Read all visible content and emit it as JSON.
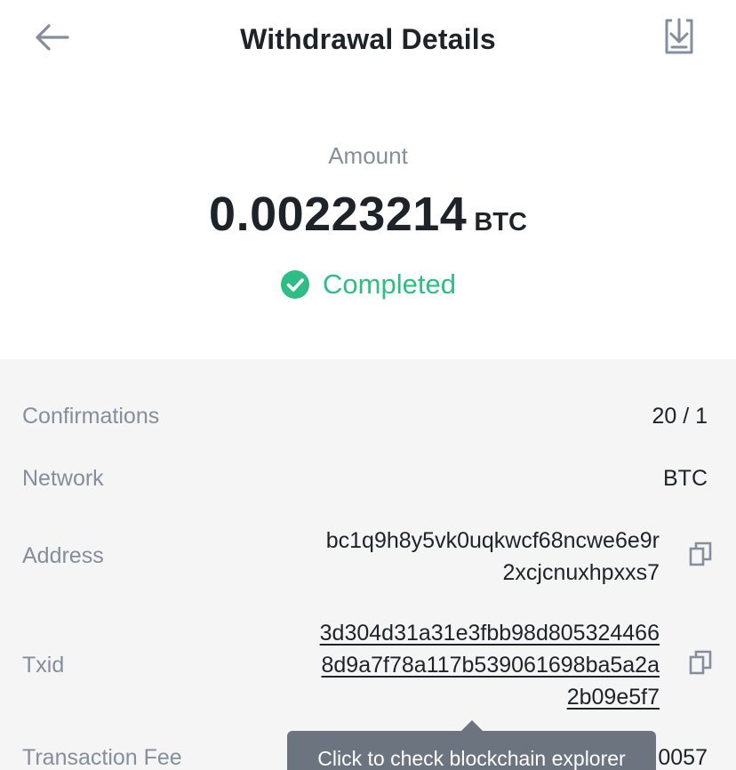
{
  "header": {
    "title": "Withdrawal Details",
    "back_icon": "arrow-left-icon",
    "download_icon": "download-icon"
  },
  "summary": {
    "amount_label": "Amount",
    "amount_value": "0.00223214",
    "amount_unit": "BTC",
    "status": "Completed",
    "status_icon": "check-circle-icon",
    "status_color": "#2ebd85"
  },
  "details": {
    "confirmations": {
      "label": "Confirmations",
      "value": "20 / 1"
    },
    "network": {
      "label": "Network",
      "value": "BTC"
    },
    "address": {
      "label": "Address",
      "lines": [
        "bc1q9h8y5vk0uqkwcf68ncwe6e9r",
        "2xcjcnuxhpxxs7"
      ],
      "copy_icon": "copy-icon"
    },
    "txid": {
      "label": "Txid",
      "lines": [
        "3d304d31a31e3fbb98d805324466",
        "8d9a7f78a117b539061698ba5a2a",
        "2b09e5f7"
      ],
      "copy_icon": "copy-icon"
    },
    "fee": {
      "label": "Transaction Fee",
      "value_visible": "0057"
    }
  },
  "tooltip": {
    "text": "Click to check blockchain explorer"
  },
  "colors": {
    "text": "#1e2329",
    "muted": "#848e9c",
    "section_bg": "#f5f5f5",
    "tooltip_bg": "#6c7480"
  }
}
